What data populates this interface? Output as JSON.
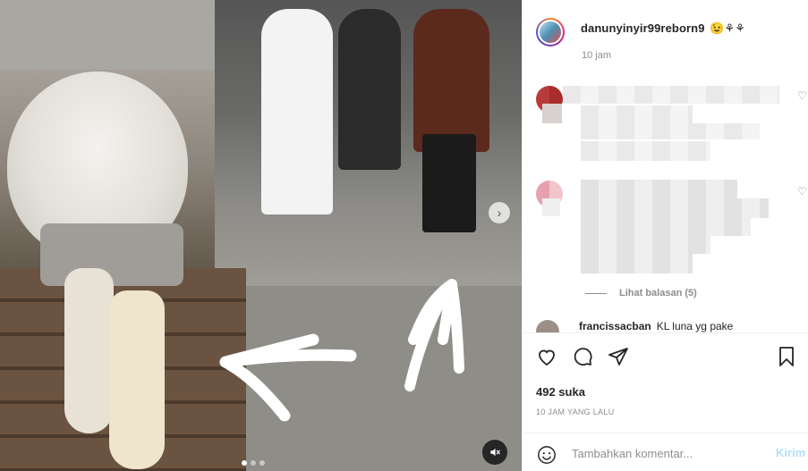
{
  "post": {
    "username": "danunyinyir99reborn9",
    "username_emoji": "😉⚘⚘",
    "posted_relative": "10 jam",
    "likes": "492 suka",
    "posted_ago": "10 JAM YANG LALU"
  },
  "comments": {
    "view_replies": "Lihat balasan (5)",
    "next_user": "francissacban",
    "next_text": "KL luna yg pake"
  },
  "composer": {
    "placeholder": "Tambahkan komentar...",
    "post_label": "Kirim"
  },
  "media": {
    "carousel_pages": 3,
    "carousel_active": 1
  },
  "icons": [
    "heart-icon",
    "comment-icon",
    "share-icon",
    "bookmark-icon",
    "emoji-icon",
    "mute-icon",
    "chevron-right-icon"
  ]
}
